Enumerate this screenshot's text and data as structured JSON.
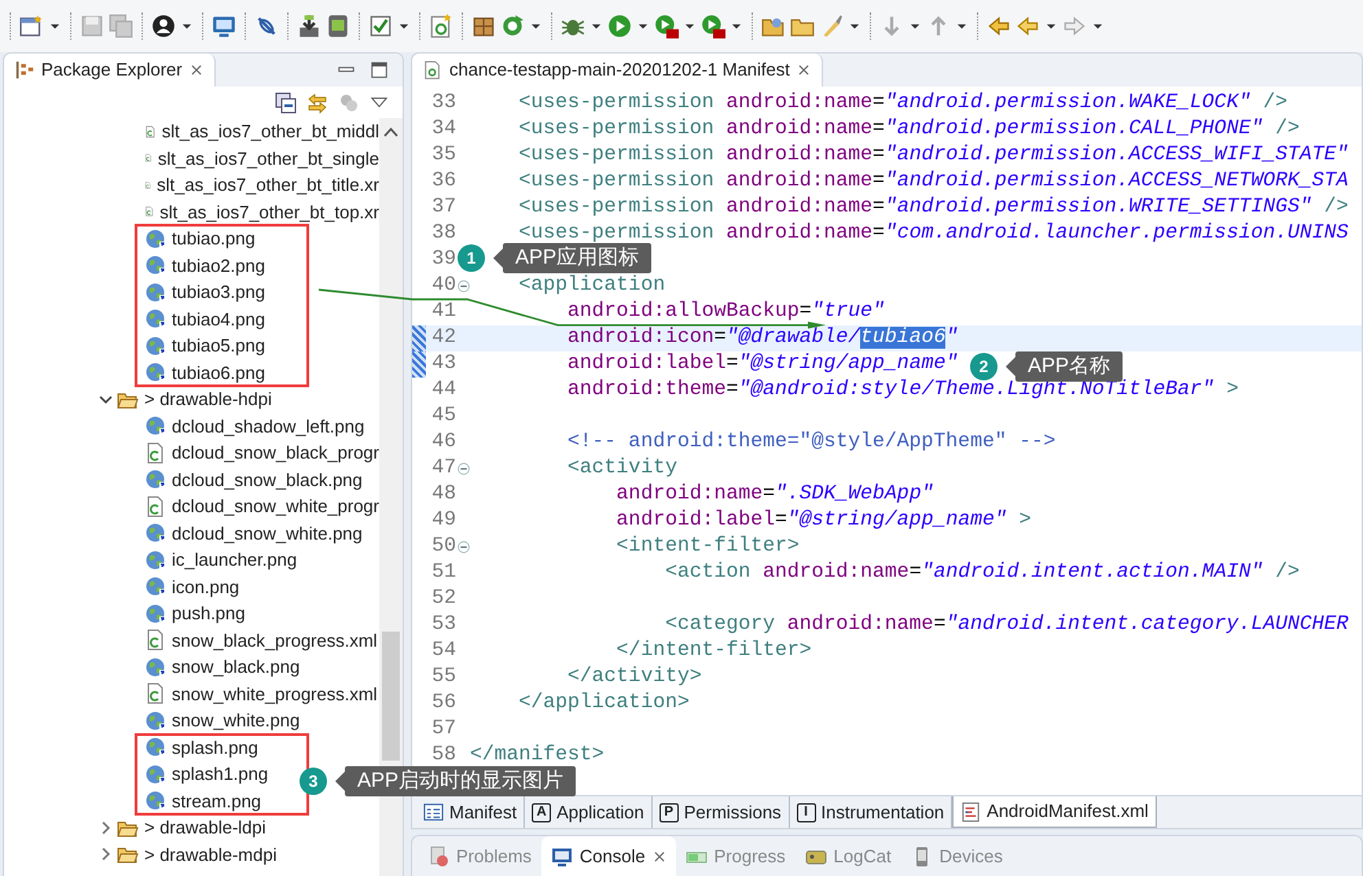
{
  "package_explorer": {
    "title": "Package Explorer",
    "selected": true,
    "tree": [
      {
        "kind": "parent-above-view",
        "children": [
          {
            "kind": "xml",
            "label": "slt_as_ios7_other_bt_middl",
            "boxed": false
          },
          {
            "kind": "xml",
            "label": "slt_as_ios7_other_bt_single",
            "boxed": false
          },
          {
            "kind": "xml",
            "label": "slt_as_ios7_other_bt_title.xr",
            "boxed": false
          },
          {
            "kind": "xml",
            "label": "slt_as_ios7_other_bt_top.xr",
            "boxed": false
          },
          {
            "kind": "png",
            "label": "tubiao.png",
            "boxed": true
          },
          {
            "kind": "png",
            "label": "tubiao2.png",
            "boxed": true
          },
          {
            "kind": "png",
            "label": "tubiao3.png",
            "boxed": true
          },
          {
            "kind": "png",
            "label": "tubiao4.png",
            "boxed": true
          },
          {
            "kind": "png",
            "label": "tubiao5.png",
            "boxed": true
          },
          {
            "kind": "png",
            "label": "tubiao6.png",
            "boxed": true
          }
        ]
      },
      {
        "kind": "folder",
        "label": "> drawable-hdpi",
        "expanded": true,
        "children": [
          {
            "kind": "png",
            "label": "dcloud_shadow_left.png",
            "boxed": false
          },
          {
            "kind": "xml",
            "label": "dcloud_snow_black_progr",
            "boxed": false
          },
          {
            "kind": "png",
            "label": "dcloud_snow_black.png",
            "boxed": false
          },
          {
            "kind": "xml",
            "label": "dcloud_snow_white_progr",
            "boxed": false
          },
          {
            "kind": "png",
            "label": "dcloud_snow_white.png",
            "boxed": false
          },
          {
            "kind": "png",
            "label": "ic_launcher.png",
            "boxed": false
          },
          {
            "kind": "png",
            "label": "icon.png",
            "boxed": false
          },
          {
            "kind": "png",
            "label": "push.png",
            "boxed": false
          },
          {
            "kind": "xml",
            "label": "snow_black_progress.xml",
            "boxed": false
          },
          {
            "kind": "png",
            "label": "snow_black.png",
            "boxed": false
          },
          {
            "kind": "xml",
            "label": "snow_white_progress.xml",
            "boxed": false
          },
          {
            "kind": "png",
            "label": "snow_white.png",
            "boxed": false
          },
          {
            "kind": "png",
            "label": "splash.png",
            "boxed": true
          },
          {
            "kind": "png",
            "label": "splash1.png",
            "boxed": true
          },
          {
            "kind": "png",
            "label": "stream.png",
            "boxed": true
          }
        ]
      },
      {
        "kind": "folder",
        "label": "> drawable-ldpi",
        "expanded": false
      },
      {
        "kind": "folder",
        "label": "> drawable-mdpi",
        "expanded": false
      }
    ]
  },
  "editor": {
    "tab": {
      "title": "chance-testapp-main-20201202-1 Manifest",
      "selected": true
    },
    "lines": [
      {
        "number": "33",
        "tokens": [
          {
            "kind": "tag",
            "text": "    <uses-permission "
          },
          {
            "kind": "attr",
            "text": "android:name"
          },
          {
            "kind": "eq",
            "text": "="
          },
          {
            "kind": "value",
            "text": "\"android.permission.WAKE_LOCK\""
          },
          {
            "kind": "tag",
            "text": " />"
          }
        ]
      },
      {
        "number": "34",
        "tokens": [
          {
            "kind": "tag",
            "text": "    <uses-permission "
          },
          {
            "kind": "attr",
            "text": "android:name"
          },
          {
            "kind": "eq",
            "text": "="
          },
          {
            "kind": "value",
            "text": "\"android.permission.CALL_PHONE\""
          },
          {
            "kind": "tag",
            "text": " />"
          }
        ]
      },
      {
        "number": "35",
        "tokens": [
          {
            "kind": "tag",
            "text": "    <uses-permission "
          },
          {
            "kind": "attr",
            "text": "android:name"
          },
          {
            "kind": "eq",
            "text": "="
          },
          {
            "kind": "value",
            "text": "\"android.permission.ACCESS_WIFI_STATE\""
          }
        ]
      },
      {
        "number": "36",
        "tokens": [
          {
            "kind": "tag",
            "text": "    <uses-permission "
          },
          {
            "kind": "attr",
            "text": "android:name"
          },
          {
            "kind": "eq",
            "text": "="
          },
          {
            "kind": "value",
            "text": "\"android.permission.ACCESS_NETWORK_STA"
          }
        ]
      },
      {
        "number": "37",
        "tokens": [
          {
            "kind": "tag",
            "text": "    <uses-permission "
          },
          {
            "kind": "attr",
            "text": "android:name"
          },
          {
            "kind": "eq",
            "text": "="
          },
          {
            "kind": "value",
            "text": "\"android.permission.WRITE_SETTINGS\""
          },
          {
            "kind": "tag",
            "text": " />"
          }
        ]
      },
      {
        "number": "38",
        "tokens": [
          {
            "kind": "tag",
            "text": "    <uses-permission "
          },
          {
            "kind": "attr",
            "text": "android:name"
          },
          {
            "kind": "eq",
            "text": "="
          },
          {
            "kind": "value",
            "text": "\"com.android.launcher.permission.UNINS"
          }
        ]
      },
      {
        "number": "39"
      },
      {
        "number": "40",
        "foldable": true,
        "tokens": [
          {
            "kind": "tag",
            "text": "    <application"
          }
        ]
      },
      {
        "number": "41",
        "tokens": [
          {
            "kind": "attr",
            "text": "        android:allowBackup"
          },
          {
            "kind": "eq",
            "text": "="
          },
          {
            "kind": "value",
            "text": "\"true\""
          }
        ]
      },
      {
        "number": "42",
        "current": true,
        "marked": true,
        "tokens": [
          {
            "kind": "attr",
            "text": "        android:icon"
          },
          {
            "kind": "eq",
            "text": "="
          },
          {
            "kind": "value",
            "text": "\"@drawable/"
          },
          {
            "kind": "value",
            "text": "tubiao6",
            "selected": true
          },
          {
            "kind": "value",
            "text": "\""
          }
        ]
      },
      {
        "number": "43",
        "marked": true,
        "tokens": [
          {
            "kind": "attr",
            "text": "        android:label"
          },
          {
            "kind": "eq",
            "text": "="
          },
          {
            "kind": "value",
            "text": "\"@string/app_name\""
          }
        ]
      },
      {
        "number": "44",
        "tokens": [
          {
            "kind": "attr",
            "text": "        android:theme"
          },
          {
            "kind": "eq",
            "text": "="
          },
          {
            "kind": "value",
            "text": "\"@android:style/Theme.Light.NoTitleBar\""
          },
          {
            "kind": "tag",
            "text": " >"
          }
        ]
      },
      {
        "number": "45"
      },
      {
        "number": "46",
        "tokens": [
          {
            "kind": "comment",
            "text": "        <!-- android:theme=\"@style/AppTheme\" -->"
          }
        ]
      },
      {
        "number": "47",
        "foldable": true,
        "tokens": [
          {
            "kind": "tag",
            "text": "        <activity"
          }
        ]
      },
      {
        "number": "48",
        "tokens": [
          {
            "kind": "attr",
            "text": "            android:name"
          },
          {
            "kind": "eq",
            "text": "="
          },
          {
            "kind": "value",
            "text": "\".SDK_WebApp\""
          }
        ]
      },
      {
        "number": "49",
        "tokens": [
          {
            "kind": "attr",
            "text": "            android:label"
          },
          {
            "kind": "eq",
            "text": "="
          },
          {
            "kind": "value",
            "text": "\"@string/app_name\""
          },
          {
            "kind": "tag",
            "text": " >"
          }
        ]
      },
      {
        "number": "50",
        "foldable": true,
        "tokens": [
          {
            "kind": "tag",
            "text": "            <intent-filter>"
          }
        ]
      },
      {
        "number": "51",
        "tokens": [
          {
            "kind": "tag",
            "text": "                <action "
          },
          {
            "kind": "attr",
            "text": "android:name"
          },
          {
            "kind": "eq",
            "text": "="
          },
          {
            "kind": "value",
            "text": "\"android.intent.action.MAIN\""
          },
          {
            "kind": "tag",
            "text": " />"
          }
        ]
      },
      {
        "number": "52"
      },
      {
        "number": "53",
        "tokens": [
          {
            "kind": "tag",
            "text": "                <category "
          },
          {
            "kind": "attr",
            "text": "android:name"
          },
          {
            "kind": "eq",
            "text": "="
          },
          {
            "kind": "value",
            "text": "\"android.intent.category.LAUNCHER"
          }
        ]
      },
      {
        "number": "54",
        "tokens": [
          {
            "kind": "tag",
            "text": "            </intent-filter>"
          }
        ]
      },
      {
        "number": "55",
        "tokens": [
          {
            "kind": "tag",
            "text": "        </activity>"
          }
        ]
      },
      {
        "number": "56",
        "tokens": [
          {
            "kind": "tag",
            "text": "    </application>"
          }
        ]
      },
      {
        "number": "57"
      },
      {
        "number": "58",
        "tokens": [
          {
            "kind": "tag",
            "text": "</manifest>"
          }
        ]
      }
    ],
    "form_tabs": [
      {
        "kind": "form",
        "label": "Manifest",
        "selected": false
      },
      {
        "kind": "letter",
        "letter": "A",
        "label": "Application",
        "selected": false
      },
      {
        "kind": "letter",
        "letter": "P",
        "label": "Permissions",
        "selected": false
      },
      {
        "kind": "letter",
        "letter": "I",
        "label": "Instrumentation",
        "selected": false
      },
      {
        "kind": "xml",
        "label": "AndroidManifest.xml",
        "selected": true
      }
    ]
  },
  "bottom_tabs": [
    {
      "kind": "problems",
      "label": "Problems",
      "selected": false
    },
    {
      "kind": "console",
      "label": "Console",
      "selected": true
    },
    {
      "kind": "progress",
      "label": "Progress",
      "selected": false
    },
    {
      "kind": "logcat",
      "label": "LogCat",
      "selected": false
    },
    {
      "kind": "devices",
      "label": "Devices",
      "selected": false
    }
  ],
  "callouts": [
    {
      "number": "1",
      "text": "APP应用图标"
    },
    {
      "number": "2",
      "text": "APP名称"
    },
    {
      "number": "3",
      "text": "APP启动时的显示图片"
    }
  ]
}
